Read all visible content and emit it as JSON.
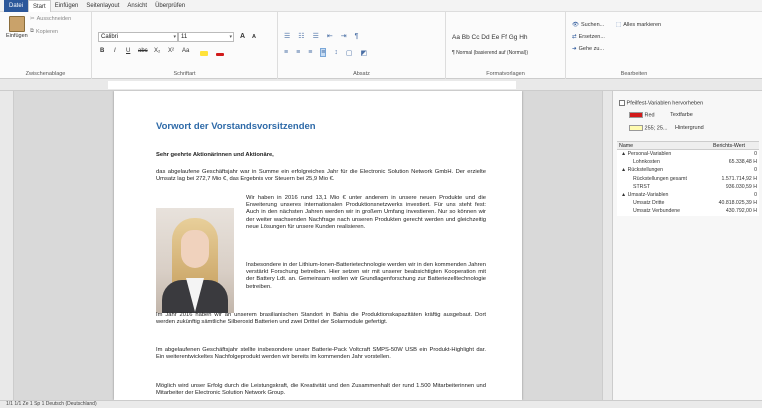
{
  "menu": [
    "Datei",
    "Start",
    "Einfügen",
    "Seitenlayout",
    "Ansicht",
    "Überprüfen"
  ],
  "ribbon": {
    "clipboard": {
      "paste": "Einfügen",
      "cut": "Ausschneiden",
      "copy": "Kopieren",
      "label": "Zwischenablage"
    },
    "font": {
      "name": "Calibri",
      "size": "11",
      "grow": "A",
      "shrink": "A",
      "bold": "B",
      "italic": "I",
      "underline": "U",
      "strike": "abc",
      "sub": "X₂",
      "sup": "X²",
      "case": "Aa",
      "label": "Schriftart"
    },
    "paragraph": {
      "label": "Absatz"
    },
    "styles": {
      "preview": "Aa Bb Cc Dd Ee Ff Gg Hh",
      "current": "¶ Normal (basierend auf (Normal))",
      "label": "Formatvorlagen"
    },
    "edit": {
      "search": "Suchen...",
      "replace": "Ersetzen...",
      "goto": "Gehe zu...",
      "selectall": "Alles markieren",
      "label": "Bearbeiten"
    }
  },
  "doc": {
    "title": "Vorwort der Vorstandsvorsitzenden",
    "salutation": "Sehr geehrte Aktionärinnen und Aktionäre,",
    "p1": "das abgelaufene Geschäftsjahr war in Summe ein erfolgreiches Jahr für die Electronic Solution Network GmbH. Der erzielte Umsatz lag bei 272,7 Mio €, das Ergebnis vor Steuern bei 25,9 Mio €.",
    "p2": "Wir haben in 2016 rund 13,1 Mio € unter anderem in unsere neuen Produkte und die Erweiterung unseres internationalen Produktionsnetzwerks investiert. Für uns steht fest: Auch in den nächsten Jahren werden wir in großem Umfang investieren. Nur so können wir der weiter wachsenden Nachfrage nach unseren Produkten gerecht werden und gleichzeitig neue Lösungen für unsere Kunden realisieren.",
    "p3": "Insbesondere in der Lithium-Ionen-Batterietechnologie werden wir in den kommenden Jahren verstärkt Forschung betreiben. Hier setzen wir mit unserer beabsichtigten Kooperation mit der Battery Ldt. an. Gemeinsam wollen wir Grundlagenforschung zur Batteriezelltechnologie betreiben.",
    "p4": "Im Jahr 2016 haben wir an unserem brasilianischen Standort in Bahia die Produktionskapazitäten kräftig ausgebaut. Dort werden zukünftig sämtliche Silberoxid Batterien und zwei Drittel der Solarmodule gefertigt.",
    "p5": "Im abgelaufenen Geschäftsjahr stellte insbesondere unser Batterie-Pack Voltcraft SMPS-50W USB ein Produkt-Highlight dar. Ein weiterentwickeltes Nachfolgeprodukt werden wir bereits im kommenden Jahr vorstellen.",
    "p6": "Möglich wird unser Erfolg durch die Leistungskraft, die Kreativität und den Zusammenhalt der rund 1.500 Mitarbeiterinnen und Mitarbeiter der Electronic Solution Network Group."
  },
  "panel": {
    "highlight_label": "Pfeilfest-Variablen hervorheben",
    "text_color_value": "Red",
    "text_color_label": "Textfarbe",
    "text_color_hex": "#d11a1a",
    "bg_color_value": "255; 25...",
    "bg_color_label": "Hintergrund",
    "bg_color_hex": "#fffbb0",
    "col_name": "Name",
    "col_value": "Berichts-Wert",
    "rows": [
      {
        "name": "▲ Personal-Variablen",
        "value": "0"
      },
      {
        "name": "Lohnkosten",
        "value": "65.338,48 H"
      },
      {
        "name": "▲ Rückstellungen",
        "value": "0"
      },
      {
        "name": "Rückstellungen gesamt",
        "value": "1.571.714,92 H"
      },
      {
        "name": "STRST",
        "value": "936.030,59 H"
      },
      {
        "name": "▲ Umsatz-Variablen",
        "value": "0"
      },
      {
        "name": "Umsatz Dritte",
        "value": "40.818.025,39 H"
      },
      {
        "name": "Umsatz Verbundene",
        "value": "430.792,00 H"
      }
    ]
  },
  "status": {
    "left": "1/1   1/1   Ze 1   Sp 1   Deutsch (Deutschland)"
  }
}
